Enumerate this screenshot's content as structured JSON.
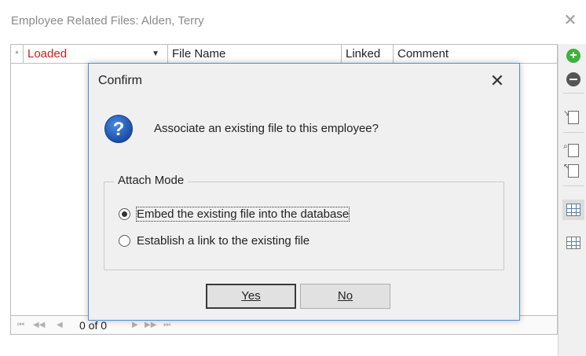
{
  "window": {
    "title": "Employee Related Files:  Alden, Terry",
    "close_glyph": "✕"
  },
  "grid": {
    "columns": [
      {
        "label": "*"
      },
      {
        "label": "Loaded",
        "color": "#d31b1b"
      },
      {
        "label": "File Name"
      },
      {
        "label": "Linked"
      },
      {
        "label": "Comment"
      }
    ],
    "dropdown_glyph": "▼"
  },
  "navigator": {
    "first": "⏮",
    "prev_page": "◀◀",
    "prev": "◀",
    "count": "0 of 0",
    "next": "▶",
    "next_page": "▶▶",
    "last": "⏭"
  },
  "toolbar": {
    "icons": [
      "add-icon",
      "remove-icon",
      "attach-file-icon",
      "find-file-icon",
      "open-file-icon",
      "grid-columns-icon",
      "export-grid-icon"
    ],
    "add_color": "#3db03d"
  },
  "dialog": {
    "title": "Confirm",
    "close_glyph": "✕",
    "question_glyph": "?",
    "message": "Associate an existing file to this employee?",
    "group_label": "Attach Mode",
    "options": [
      {
        "label": "Embed the existing file into the database",
        "selected": true
      },
      {
        "label": "Establish a link to the existing file",
        "selected": false
      }
    ],
    "yes_label": "Yes",
    "no_label": "No"
  }
}
